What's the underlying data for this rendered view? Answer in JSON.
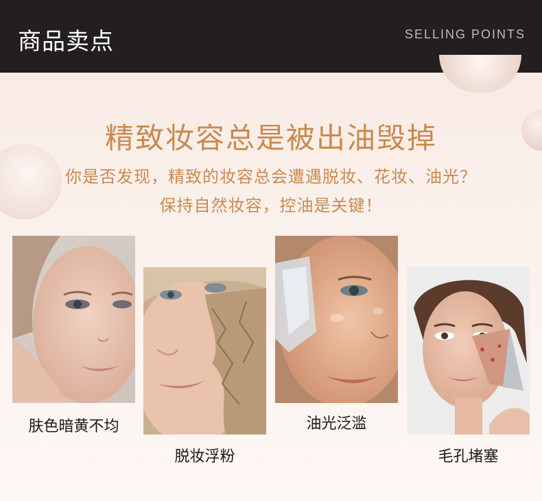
{
  "header": {
    "title": "商品卖点",
    "subtitle": "SELLING POINTS"
  },
  "headline": "精致妆容总是被出油毁掉",
  "description": {
    "line1": "你是否发现，精致的妆容总会遭遇脱妆、花妆、油光？",
    "line2": "保持自然妆容，控油是关键！"
  },
  "items": [
    {
      "caption": "肤色暗黄不均",
      "image": "face-portrait-hand-on-cheek"
    },
    {
      "caption": "脱妆浮粉",
      "image": "face-cracked-makeup"
    },
    {
      "caption": "油光泛滥",
      "image": "face-oily-with-ice-cube"
    },
    {
      "caption": "毛孔堵塞",
      "image": "face-peeling-acne-patch"
    }
  ],
  "colors": {
    "header_bg": "#231f20",
    "headline": "#c98a4e",
    "background": "#f7e8e1"
  }
}
